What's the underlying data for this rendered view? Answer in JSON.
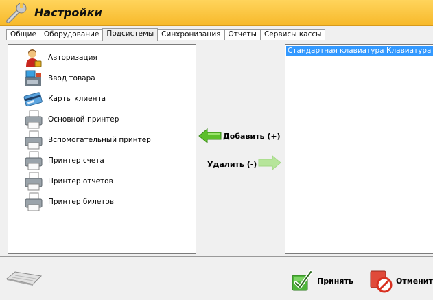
{
  "window": {
    "title": "Настройки"
  },
  "tabs": [
    {
      "label": "Общие",
      "active": false
    },
    {
      "label": "Оборудование",
      "active": false
    },
    {
      "label": "Подсистемы",
      "active": true
    },
    {
      "label": "Синхронизация",
      "active": false
    },
    {
      "label": "Отчеты",
      "active": false
    },
    {
      "label": "Сервисы кассы",
      "active": false
    }
  ],
  "available_subsystems": [
    {
      "label": "Авторизация",
      "icon": "user-lock-icon"
    },
    {
      "label": "Ввод товара",
      "icon": "cash-register-icon"
    },
    {
      "label": "Карты клиента",
      "icon": "client-card-icon"
    },
    {
      "label": "Основной принтер",
      "icon": "printer-icon"
    },
    {
      "label": "Вспомогательный принтер",
      "icon": "printer-icon"
    },
    {
      "label": "Принтер счета",
      "icon": "printer-icon"
    },
    {
      "label": "Принтер отчетов",
      "icon": "printer-icon"
    },
    {
      "label": "Принтер билетов",
      "icon": "printer-icon"
    }
  ],
  "active_subsystems": [
    {
      "name": "Стандартная клавиатура",
      "type": "Клавиатура"
    }
  ],
  "actions": {
    "add_label": "Добавить (+)",
    "remove_label": "Удалить (-)"
  },
  "footer": {
    "accept_label": "Принять",
    "cancel_label": "Отменить"
  },
  "colors": {
    "title_bar": "#f7b92a",
    "selection": "#3399ff",
    "add_arrow": "#5cbf2a",
    "remove_arrow_disabled": "#b6e59a"
  }
}
